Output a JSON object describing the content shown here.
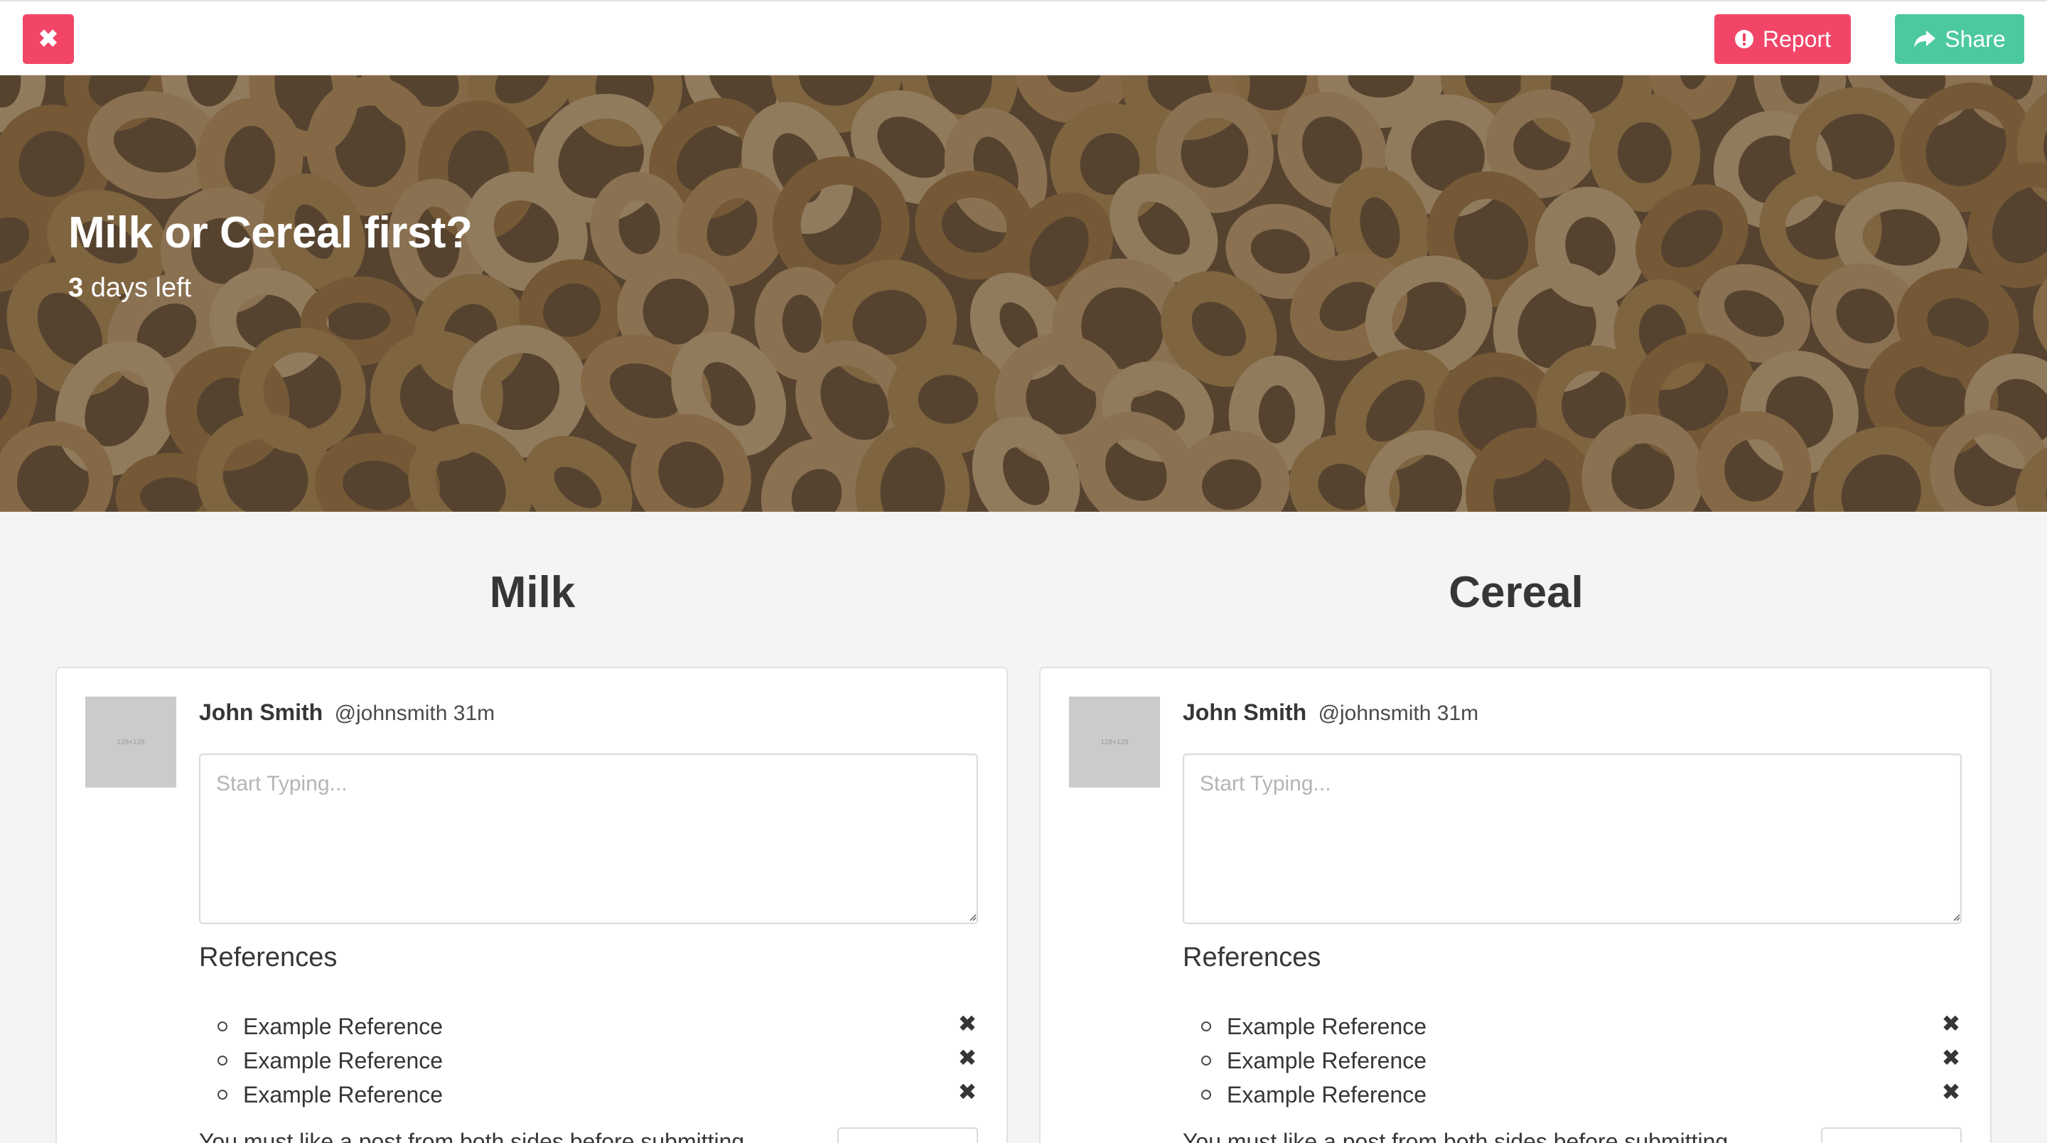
{
  "topbar": {
    "close_icon": "times-icon",
    "report_label": "Report",
    "report_icon": "exclamation-circle-icon",
    "share_label": "Share",
    "share_icon": "share-icon",
    "colors": {
      "danger": "#f14668",
      "success": "#4dc9a0"
    }
  },
  "hero": {
    "title": "Milk or Cereal first?",
    "days_count": "3",
    "days_suffix": " days left",
    "background": "cereal-photo"
  },
  "sides": [
    {
      "title": "Milk",
      "post": {
        "avatar_text": "128×128",
        "name": "John Smith",
        "handle": "@johnsmith",
        "time": "31m",
        "placeholder": "Start Typing...",
        "references_heading": "References",
        "references": [
          "Example Reference",
          "Example Reference",
          "Example Reference"
        ],
        "note": "You must like a post from both sides before submitting."
      }
    },
    {
      "title": "Cereal",
      "post": {
        "avatar_text": "128×128",
        "name": "John Smith",
        "handle": "@johnsmith",
        "time": "31m",
        "placeholder": "Start Typing...",
        "references_heading": "References",
        "references": [
          "Example Reference",
          "Example Reference",
          "Example Reference"
        ],
        "note": "You must like a post from both sides before submitting."
      }
    }
  ]
}
